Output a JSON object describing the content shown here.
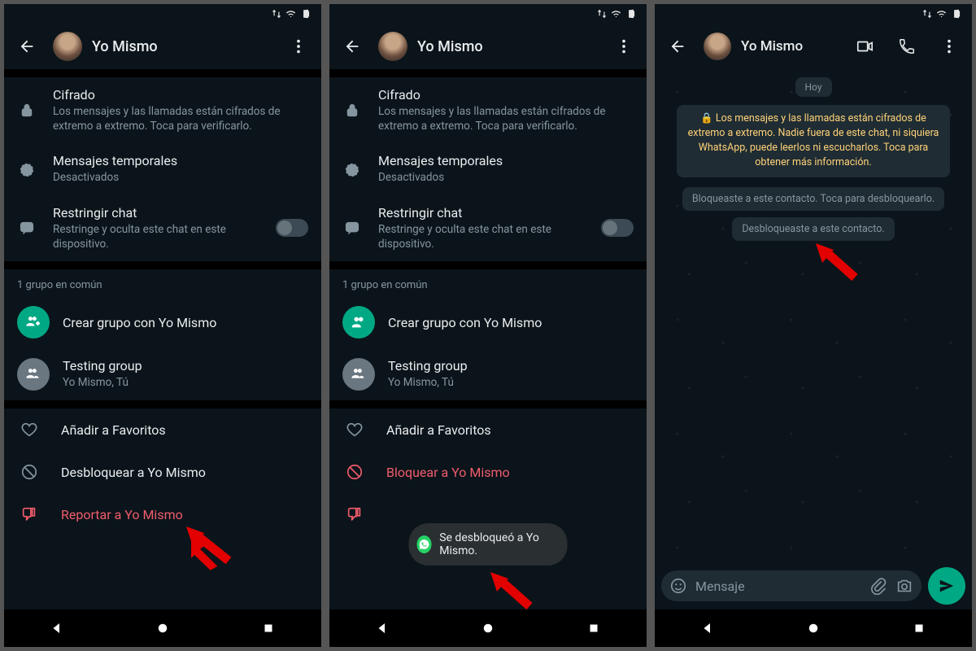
{
  "header": {
    "title": "Yo Mismo"
  },
  "rows": {
    "encryption": {
      "title": "Cifrado",
      "sub": "Los mensajes y las llamadas están cifrados de extremo a extremo. Toca para verificarlo."
    },
    "disappearing": {
      "title": "Mensajes temporales",
      "sub": "Desactivados"
    },
    "restrict": {
      "title": "Restringir chat",
      "sub": "Restringe y oculta este chat en este dispositivo."
    }
  },
  "groups": {
    "label": "1 grupo en común",
    "create": "Crear grupo con Yo Mismo",
    "g1": {
      "title": "Testing group",
      "sub": "Yo Mismo, Tú"
    }
  },
  "actions": {
    "fav": "Añadir a Favoritos",
    "unblock": "Desbloquear a Yo Mismo",
    "block": "Bloquear a Yo Mismo",
    "report": "Reportar a Yo Mismo"
  },
  "toast": "Se desbloqueó a Yo Mismo.",
  "chat": {
    "date": "Hoy",
    "encryption": "Los mensajes y las llamadas están cifrados de extremo a extremo. Nadie fuera de este chat, ni siquiera WhatsApp, puede leerlos ni escucharlos. Toca para obtener más información.",
    "blocked": "Bloqueaste a este contacto. Toca para desbloquearlo.",
    "unblocked": "Desbloqueaste a este contacto.",
    "placeholder": "Mensaje"
  }
}
